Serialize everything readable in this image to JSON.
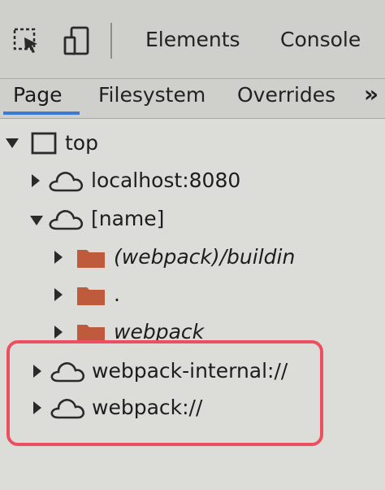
{
  "toolbar": {
    "icons": [
      "inspect-element-icon",
      "device-toolbar-icon"
    ],
    "tabs": [
      {
        "label": "Elements"
      },
      {
        "label": "Console"
      }
    ]
  },
  "sources_sidebar": {
    "tabs": [
      {
        "label": "Page",
        "active": true
      },
      {
        "label": "Filesystem",
        "active": false
      },
      {
        "label": "Overrides",
        "active": false
      }
    ],
    "more_label": "»"
  },
  "tree": {
    "top": {
      "label": "top",
      "expanded": true
    },
    "items": [
      {
        "label": "localhost:8080",
        "type": "origin",
        "expanded": false
      },
      {
        "label": "[name]",
        "type": "origin",
        "expanded": true
      },
      {
        "label": "(webpack)/buildin",
        "type": "folder",
        "expanded": false
      },
      {
        "label": ".",
        "type": "folder",
        "expanded": false
      },
      {
        "label": "webpack",
        "type": "folder",
        "expanded": false
      },
      {
        "label": "webpack-internal://",
        "type": "origin",
        "expanded": false
      },
      {
        "label": "webpack://",
        "type": "origin",
        "expanded": false
      }
    ]
  },
  "colors": {
    "folder": "#c05a3c",
    "highlight": "#ee4f60",
    "active_tab_underline": "#3a7bd5"
  }
}
